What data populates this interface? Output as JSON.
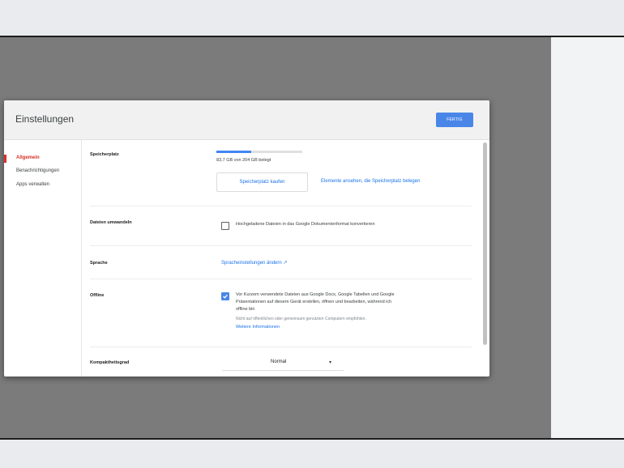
{
  "dialog": {
    "title": "Einstellungen",
    "done_label": "FERTIG"
  },
  "nav": {
    "items": [
      {
        "label": "Allgemein",
        "active": true
      },
      {
        "label": "Benachrichtigungen",
        "active": false
      },
      {
        "label": "Apps verwalten",
        "active": false
      }
    ]
  },
  "storage": {
    "label": "Speicherplatz",
    "usage_text": "83,7 GB von 204 GB belegt",
    "used_fraction": 0.41,
    "buy_label": "Speicherplatz kaufen",
    "view_link": "Elemente ansehen, die Speicherplatz belegen"
  },
  "convert": {
    "label": "Dateien umwandeln",
    "checkbox_text": "Hochgeladene Dateien in das Google Dokumentenformat konvertieren",
    "checked": false
  },
  "language": {
    "label": "Sprache",
    "link": "Spracheinstellungen ändern"
  },
  "offline": {
    "label": "Offline",
    "checked": true,
    "text_line1": "Vor Kurzem verwendete Dateien aus Google Docs, Google Tabellen und Google",
    "text_line2": "Präsentationen auf diesem Gerät erstellen, öffnen und bearbeiten, während ich",
    "text_line3": "offline bin",
    "hint": "Nicht auf öffentlichen oder gemeinsam genutzten Computern empfohlen.",
    "more_link": "Weitere Informationen"
  },
  "density": {
    "label": "Kompaktheitsgrad",
    "value": "Normal"
  },
  "colors": {
    "accent": "#4a86e8",
    "nav_active": "#d93025",
    "link": "#1a73e8",
    "overlay": "#7b7b7b"
  }
}
